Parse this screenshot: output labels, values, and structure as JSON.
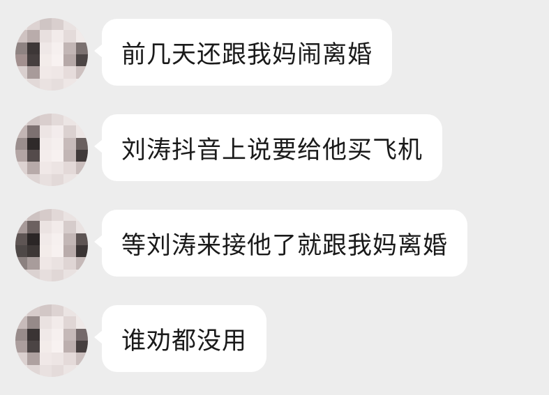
{
  "chat": {
    "messages": [
      {
        "text": "前几天还跟我妈闹离婚"
      },
      {
        "text": "刘涛抖音上说要给他买飞机"
      },
      {
        "text": "等刘涛来接他了就跟我妈离婚"
      },
      {
        "text": "谁劝都没用"
      }
    ]
  },
  "avatar": {
    "icon": "pixelated-avatar-icon",
    "blur_colors": [
      "#efe6e4",
      "#d8cccb",
      "#3b3636",
      "#8a7f7d",
      "#c9bcbb",
      "#f6efed"
    ]
  },
  "colors": {
    "background": "#ededed",
    "bubble": "#ffffff",
    "text": "#1a1a1a"
  }
}
